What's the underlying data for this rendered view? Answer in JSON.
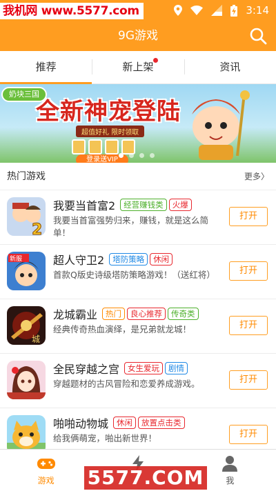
{
  "watermark_top": "我机网 www.5577.com",
  "status": {
    "time": "3:14"
  },
  "appbar": {
    "title": "9G游戏",
    "search_icon": "search-icon"
  },
  "tabs": [
    {
      "label": "推荐",
      "active": true
    },
    {
      "label": "新上架",
      "active": false,
      "badge": true
    },
    {
      "label": "资讯",
      "active": false
    }
  ],
  "banner": {
    "logo_text": "奶块三国",
    "headline": "全新神宠登陆",
    "subtag": "超值好礼 限时领取",
    "vip_text": "登录送VIP",
    "dots": 4,
    "active_dot": 0
  },
  "section": {
    "title": "热门游戏",
    "more": "更多〉"
  },
  "games": [
    {
      "name": "我要当首富2",
      "tags": [
        {
          "text": "经营赚钱类",
          "color": "green"
        },
        {
          "text": "火爆",
          "color": "red"
        }
      ],
      "desc": "我要当首富强势归来，赚钱，就是这么简单！",
      "button": "打开",
      "icon": "tycoon-game-icon"
    },
    {
      "name": "超人守卫2",
      "tags": [
        {
          "text": "塔防策略",
          "color": "blue"
        },
        {
          "text": "休闲",
          "color": "red"
        }
      ],
      "desc": "首款Q版史诗级塔防策略游戏！（送红将）",
      "button": "打开",
      "icon": "superman-guard-icon"
    },
    {
      "name": "龙城霸业",
      "tags": [
        {
          "text": "热门",
          "color": "orange"
        },
        {
          "text": "良心推荐",
          "color": "red"
        },
        {
          "text": "传奇类",
          "color": "green"
        }
      ],
      "desc": "经典传奇热血演绎，是兄弟就龙城！",
      "button": "打开",
      "icon": "dragon-city-icon"
    },
    {
      "name": "全民穿越之宫",
      "tags": [
        {
          "text": "女生爱玩",
          "color": "red"
        },
        {
          "text": "剧情",
          "color": "blue"
        }
      ],
      "desc": "穿越题材的古风冒险和恋爱养成游戏。",
      "button": "打开",
      "icon": "palace-game-icon"
    },
    {
      "name": "啪啪动物城",
      "tags": [
        {
          "text": "休闲",
          "color": "red"
        },
        {
          "text": "放置点击类",
          "color": "red"
        }
      ],
      "desc": "给我俩萌宠，啪出新世界！",
      "button": "打开",
      "icon": "animal-city-icon"
    }
  ],
  "bottom_nav": [
    {
      "label": "游戏",
      "icon": "gamepad-icon",
      "active": true
    },
    {
      "label": "",
      "icon": "lightning-icon",
      "active": false
    },
    {
      "label": "我",
      "icon": "person-icon",
      "active": false
    }
  ],
  "watermark_bottom": "5577.COM",
  "colors": {
    "accent": "#ff9d20",
    "red": "#e8262d",
    "green": "#4caf2a",
    "blue": "#1e88e5"
  }
}
